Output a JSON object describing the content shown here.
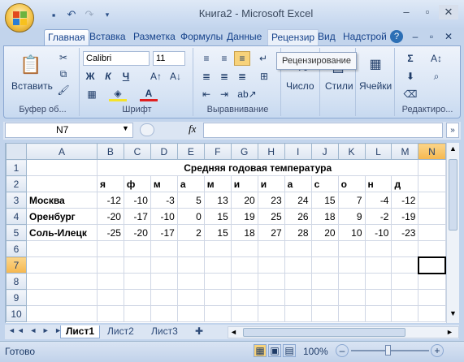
{
  "window": {
    "title": "Книга2 - Microsoft Excel"
  },
  "ribbon_tabs": [
    "Главная",
    "Вставка",
    "Разметка",
    "Формулы",
    "Данные",
    "Рецензир",
    "Вид",
    "Надстрой"
  ],
  "ribbon": {
    "paste_label": "Вставить",
    "font_name": "Calibri",
    "font_size": "11",
    "bold": "Ж",
    "italic": "К",
    "underline": "Ч",
    "number_label": "Число",
    "styles_label": "Стили",
    "cells_label": "Ячейки",
    "groups": {
      "clipboard": "Буфер об...",
      "font": "Шрифт",
      "alignment": "Выравнивание",
      "editing": "Редактиро..."
    },
    "tooltip": "Рецензирование"
  },
  "formula_bar": {
    "cell_ref": "N7",
    "fx": "fx",
    "formula": ""
  },
  "sheet": {
    "columns": [
      "A",
      "B",
      "C",
      "D",
      "E",
      "F",
      "G",
      "H",
      "I",
      "J",
      "K",
      "L",
      "M",
      "N"
    ],
    "rows": [
      [
        "",
        "Средняя годовая температура",
        "",
        "",
        "",
        "",
        "",
        "",
        "",
        "",
        "",
        "",
        "",
        ""
      ],
      [
        "",
        "я",
        "ф",
        "м",
        "а",
        "м",
        "и",
        "и",
        "а",
        "с",
        "о",
        "н",
        "д",
        ""
      ],
      [
        "Москва",
        "-12",
        "-10",
        "-3",
        "5",
        "13",
        "20",
        "23",
        "24",
        "15",
        "7",
        "-4",
        "-12",
        ""
      ],
      [
        "Оренбург",
        "-20",
        "-17",
        "-10",
        "0",
        "15",
        "19",
        "25",
        "26",
        "18",
        "9",
        "-2",
        "-19",
        ""
      ],
      [
        "Соль-Илецк",
        "-25",
        "-20",
        "-17",
        "2",
        "15",
        "18",
        "27",
        "28",
        "20",
        "10",
        "-10",
        "-23",
        ""
      ],
      [
        "",
        "",
        "",
        "",
        "",
        "",
        "",
        "",
        "",
        "",
        "",
        "",
        "",
        ""
      ],
      [
        "",
        "",
        "",
        "",
        "",
        "",
        "",
        "",
        "",
        "",
        "",
        "",
        "",
        ""
      ],
      [
        "",
        "",
        "",
        "",
        "",
        "",
        "",
        "",
        "",
        "",
        "",
        "",
        "",
        ""
      ],
      [
        "",
        "",
        "",
        "",
        "",
        "",
        "",
        "",
        "",
        "",
        "",
        "",
        "",
        ""
      ],
      [
        "",
        "",
        "",
        "",
        "",
        "",
        "",
        "",
        "",
        "",
        "",
        "",
        "",
        ""
      ]
    ]
  },
  "sheet_tabs": [
    "Лист1",
    "Лист2",
    "Лист3"
  ],
  "status": {
    "ready": "Готово",
    "zoom": "100%"
  }
}
